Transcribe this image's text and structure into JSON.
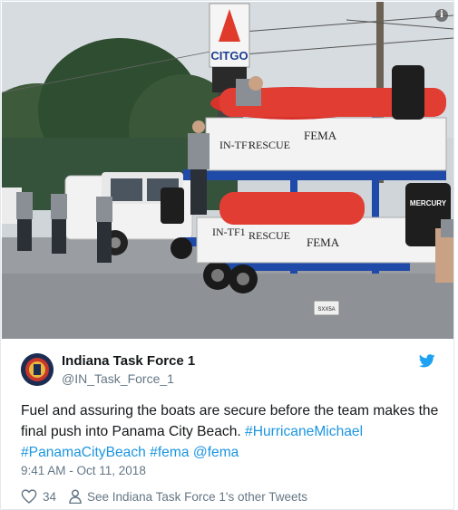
{
  "tweet": {
    "author_name": "Indiana Task Force 1",
    "author_handle": "@IN_Task_Force_1",
    "text_parts": {
      "p1": "Fuel and assuring the boats are secure before the team makes the final push into Panama City Beach. ",
      "h1": "#HurricaneMichael",
      "h2": "#PanamaCityBeach",
      "h3": "#fema",
      "h4": "@fema"
    },
    "timestamp": "9:41 AM - Oct 11, 2018",
    "likes": "34",
    "other_tweets_link": "See Indiana Task Force 1's other Tweets"
  },
  "photo": {
    "sign_brand": "CITGO",
    "boat_labels": [
      "IN-TF1",
      "RESCUE",
      "FEMA"
    ],
    "motor_brand": "MERCURY",
    "license_plate": "SXX5A"
  },
  "colors": {
    "link": "#1b95e0",
    "twitter_blue": "#1da1f2",
    "secondary_text": "#657786"
  },
  "icons": [
    "info-icon",
    "twitter-bird-icon",
    "heart-icon",
    "person-icon"
  ]
}
